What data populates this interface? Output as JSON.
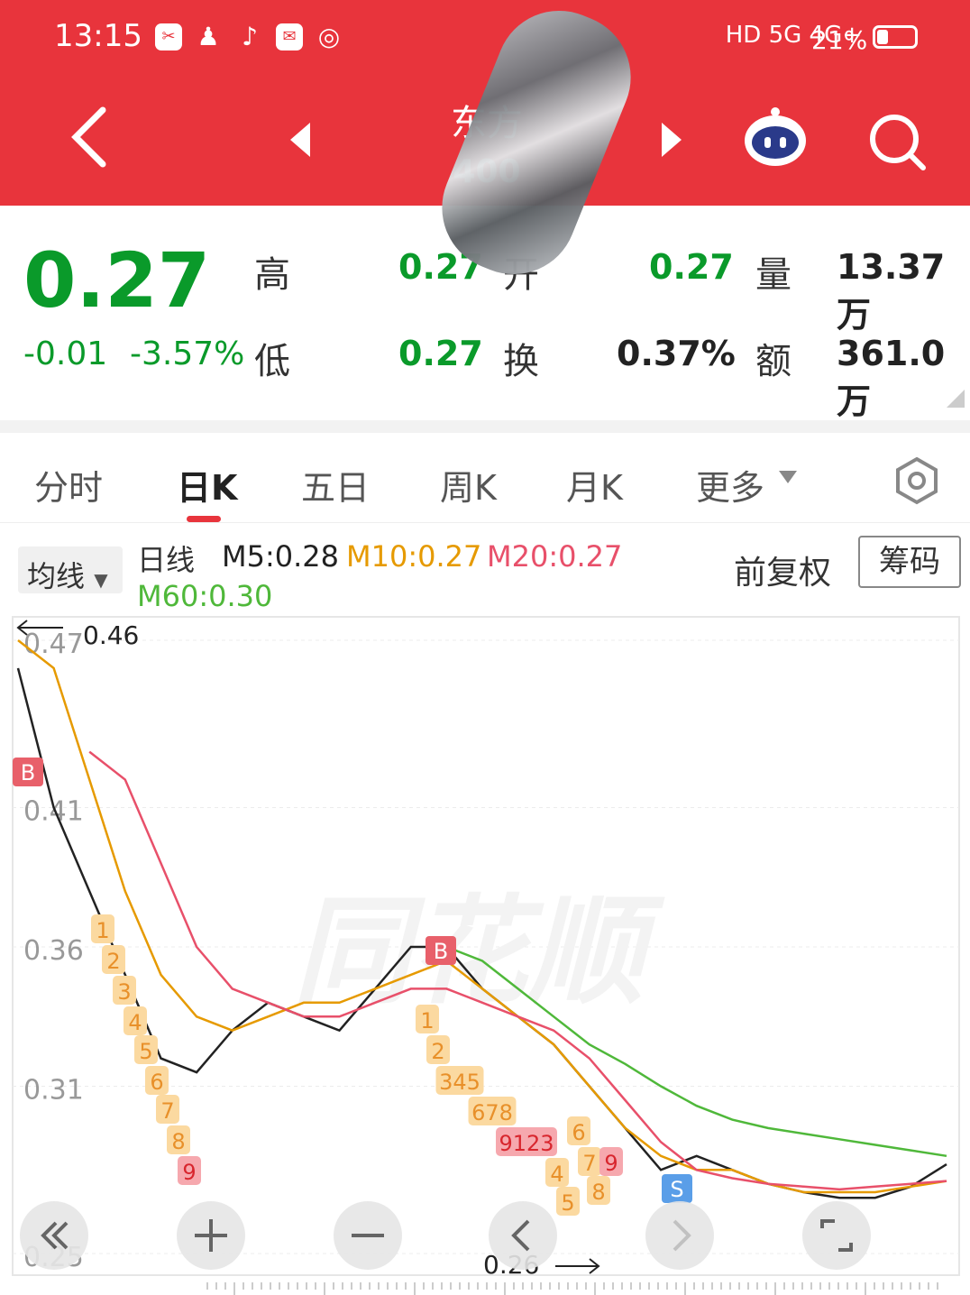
{
  "status_bar": {
    "time": "13:15",
    "app_icons": [
      "camera-icon",
      "penguin-icon",
      "tiktok-icon",
      "mail-icon",
      "planet-icon"
    ],
    "network_right": "HD 5G 4G+",
    "battery": "21%"
  },
  "header": {
    "stock_name": "东方",
    "stock_code": "400",
    "colors": {
      "brand": "#e8343c"
    }
  },
  "quote": {
    "price": "0.27",
    "change": "-0.01",
    "change_pct": "-3.57%",
    "high_label": "高",
    "high": "0.27",
    "open_label": "开",
    "open": "0.27",
    "low_label": "低",
    "low": "0.27",
    "turnover_label": "换",
    "turnover": "0.37%",
    "volume_label": "量",
    "volume": "13.37万",
    "amount_label": "额",
    "amount": "361.0万",
    "colors": {
      "down": "#0a9a2a",
      "text": "#222"
    }
  },
  "tabs": [
    {
      "label": "分时"
    },
    {
      "label": "日K",
      "active": true
    },
    {
      "label": "五日"
    },
    {
      "label": "周K"
    },
    {
      "label": "月K"
    },
    {
      "label": "更多"
    }
  ],
  "ma_bar": {
    "dropdown_label": "均线",
    "line_label": "日线",
    "m5": "M5:0.28",
    "m10": "M10:0.27",
    "m20": "M20:0.27",
    "m60": "M60:0.30",
    "adjust_label": "前复权",
    "chip_label": "筹码",
    "colors": {
      "m5": "#222222",
      "m10": "#e69a00",
      "m20": "#e8506a",
      "m60": "#4fb83a"
    }
  },
  "chart_data": {
    "type": "line",
    "y_ticks": [
      "0.47",
      "0.41",
      "0.36",
      "0.31",
      "0.25"
    ],
    "max_marker": "0.46",
    "min_marker": "0.26",
    "watermark": "同花顺",
    "ylim": [
      0.25,
      0.47
    ],
    "series": [
      {
        "name": "M5",
        "values": [
          0.46,
          0.41,
          0.38,
          0.35,
          0.32,
          0.315,
          0.33,
          0.34,
          0.335,
          0.33,
          0.345,
          0.36,
          0.36,
          0.345,
          0.335,
          0.325,
          0.31,
          0.295,
          0.28,
          0.285,
          0.28,
          0.275,
          0.272,
          0.27,
          0.27,
          0.274,
          0.282
        ]
      },
      {
        "name": "M10",
        "values": [
          0.47,
          0.46,
          0.42,
          0.38,
          0.35,
          0.335,
          0.33,
          0.335,
          0.34,
          0.34,
          0.345,
          0.35,
          0.355,
          0.345,
          0.335,
          0.325,
          0.31,
          0.295,
          0.285,
          0.28,
          0.28,
          0.275,
          0.272,
          0.272,
          0.272,
          0.274,
          0.276
        ]
      },
      {
        "name": "M20",
        "values": [
          null,
          null,
          0.43,
          0.42,
          0.39,
          0.36,
          0.345,
          0.34,
          0.335,
          0.335,
          0.34,
          0.345,
          0.345,
          0.34,
          0.335,
          0.33,
          0.32,
          0.305,
          0.29,
          0.28,
          0.277,
          0.275,
          0.274,
          0.273,
          0.274,
          0.275,
          0.276
        ]
      },
      {
        "name": "M60",
        "values": [
          null,
          null,
          null,
          null,
          null,
          null,
          null,
          null,
          null,
          null,
          null,
          null,
          0.36,
          0.355,
          0.345,
          0.335,
          0.325,
          0.318,
          0.31,
          0.303,
          0.298,
          0.295,
          0.293,
          0.291,
          0.289,
          0.287,
          0.285
        ]
      }
    ],
    "signal_labels": [
      "B",
      "B",
      "S"
    ],
    "sequence_labels": [
      "1",
      "2",
      "3",
      "4",
      "5",
      "6",
      "7",
      "8",
      "9",
      "1",
      "2",
      "345",
      "678",
      "9123",
      "6",
      "4",
      "7",
      "5",
      "8",
      "9"
    ]
  }
}
